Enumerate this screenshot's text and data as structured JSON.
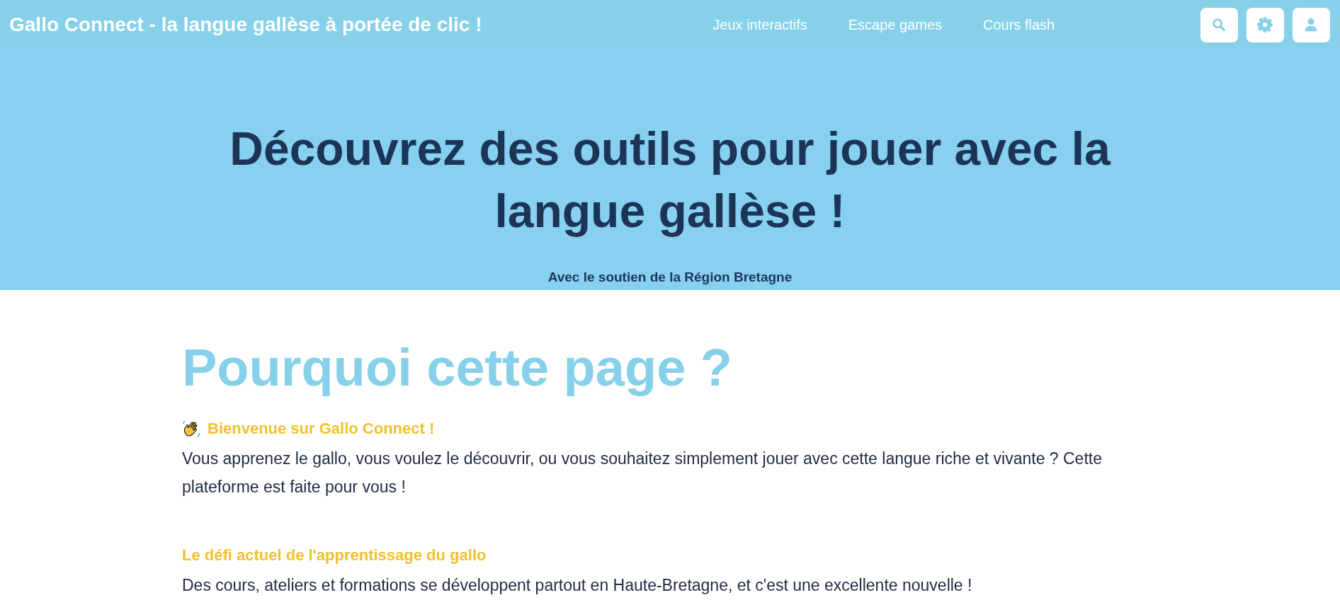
{
  "header": {
    "title": "Gallo Connect - la langue gallèse à portée de clic !",
    "nav": [
      {
        "label": "Jeux interactifs"
      },
      {
        "label": "Escape games"
      },
      {
        "label": "Cours flash"
      }
    ],
    "actions": [
      {
        "kind": "search"
      },
      {
        "kind": "settings"
      },
      {
        "kind": "account"
      }
    ]
  },
  "hero": {
    "title": "Découvrez des outils pour jouer avec la langue gallèse !",
    "subtitle": "Avec le soutien de la Région Bretagne"
  },
  "main": {
    "title": "Pourquoi cette page ?",
    "sections": [
      {
        "heading": "Bienvenue sur Gallo Connect !",
        "kind": "greeting",
        "text": "Vous apprenez le gallo, vous voulez le découvrir, ou vous souhaitez simplement jouer avec cette langue riche et vivante ? Cette plateforme est faite pour vous !"
      },
      {
        "heading": "Le défi actuel de l'apprentissage du gallo",
        "text": "Des cours, ateliers et formations se développent partout en Haute-Bretagne, et c'est une excellente nouvelle !"
      }
    ]
  }
}
